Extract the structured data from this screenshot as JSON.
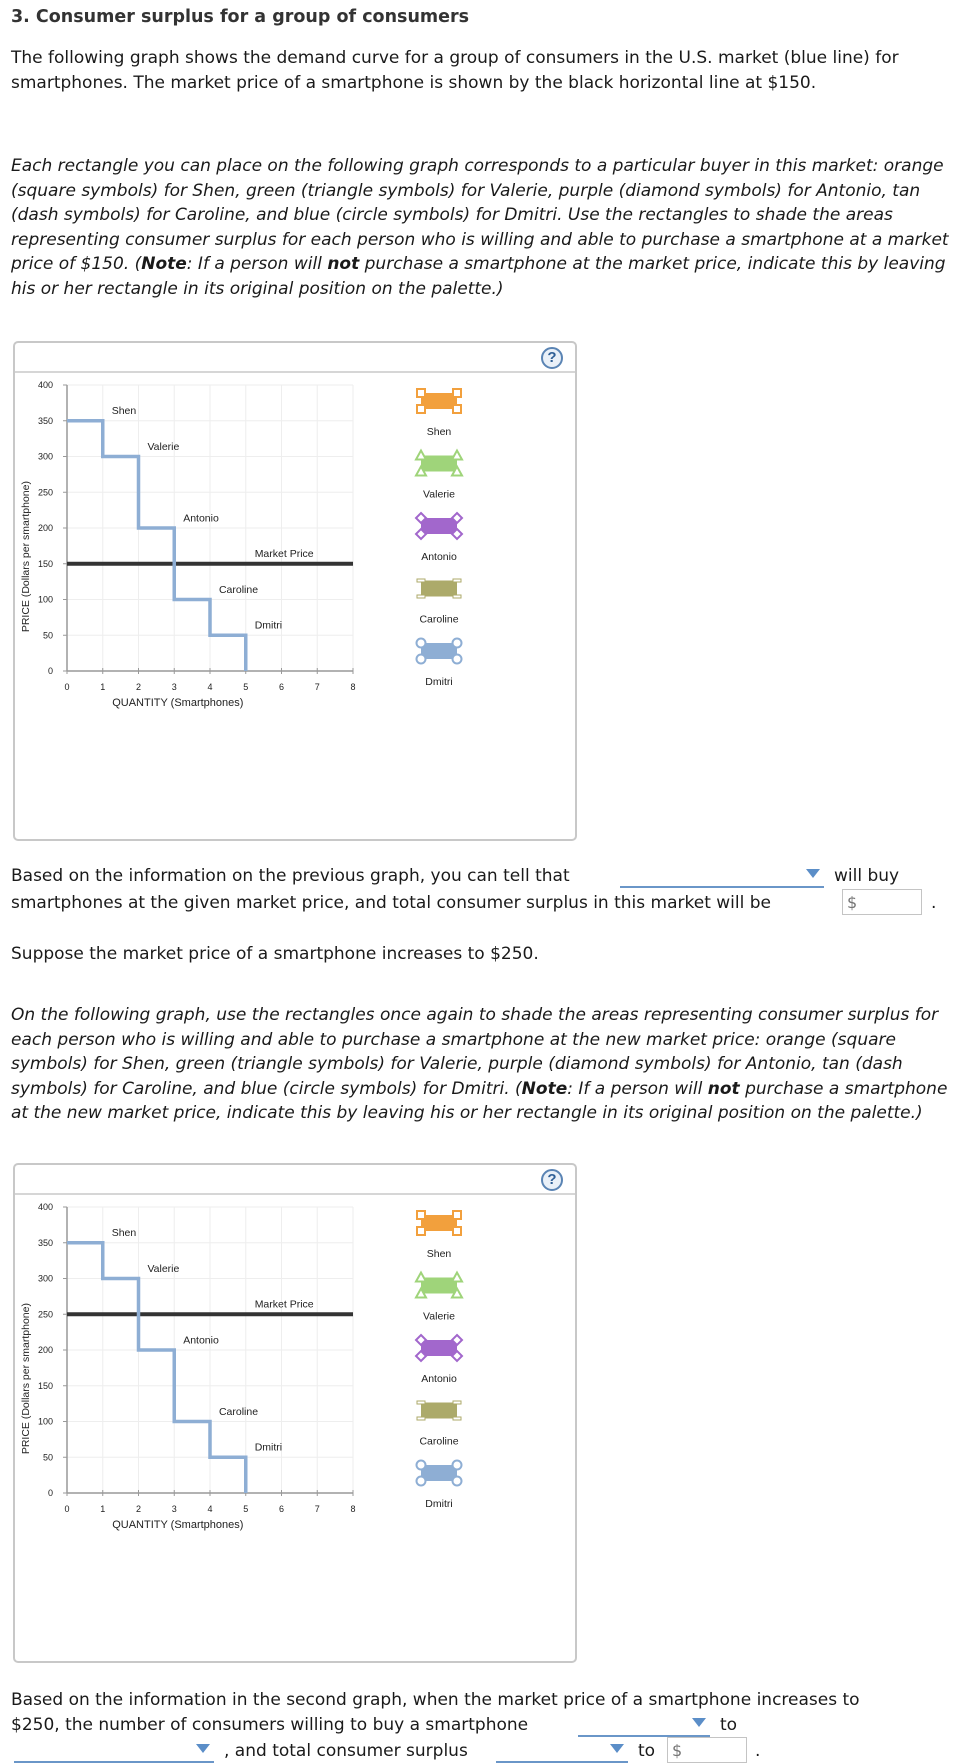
{
  "heading": "3. Consumer surplus for a group of consumers",
  "intro": "The following graph shows the demand curve for a group of consumers in the U.S. market (blue line) for smartphones. The market price of a smartphone is shown by the black horizontal line at $150.",
  "instructions1": {
    "part1": "Each rectangle you can place on the following graph corresponds to a particular buyer in this market: orange (square symbols) for Shen, green (triangle symbols) for Valerie, purple (diamond symbols) for Antonio, tan (dash symbols) for Caroline, and blue (circle symbols) for Dmitri. Use the rectangles to shade the areas representing consumer surplus for each person who is willing and able to purchase a smartphone at a market price of $150. (",
    "note": "Note",
    "part2": ": If a person will ",
    "not": "not",
    "part3": " purchase a smartphone at the market price, indicate this by leaving his or her rectangle in its original position on the palette.)"
  },
  "question1": {
    "before": "Based on the information on the previous graph, you can tell that",
    "after": "will buy",
    "line2": "smartphones at the given market price, and total consumer surplus in this market will be",
    "dollar_placeholder": "$",
    "end": ".",
    "dropdown_value": ""
  },
  "suppose": "Suppose the market price of a smartphone increases to $250.",
  "instructions2": {
    "part1": "On the following graph, use the rectangles once again to shade the areas representing consumer surplus for each person who is willing and able to purchase a smartphone at the new market price: orange (square symbols) for Shen, green (triangle symbols) for Valerie, purple (diamond symbols) for Antonio, tan (dash symbols) for Caroline, and blue (circle symbols) for Dmitri. (",
    "note": "Note",
    "part2": ": If a person will ",
    "not": "not",
    "part3": " purchase a smartphone at the new market price, indicate this by leaving his or her rectangle in its original position on the palette.)"
  },
  "question2": {
    "line1": "Based on the information in the second graph, when the market price of a smartphone increases to",
    "line2_before": "$250, the number of consumers willing to buy a smartphone",
    "to1": "to",
    "and_total": ", and total consumer surplus",
    "to2": "to",
    "dollar_placeholder": "$",
    "end": "."
  },
  "help_label": "?",
  "palette": [
    {
      "name": "Shen",
      "symbol": "square",
      "color": "#f2a03d"
    },
    {
      "name": "Valerie",
      "symbol": "triangle",
      "color": "#9fd47a"
    },
    {
      "name": "Antonio",
      "symbol": "diamond",
      "color": "#a267cc"
    },
    {
      "name": "Caroline",
      "symbol": "dash",
      "color": "#acaa6a"
    },
    {
      "name": "Dmitri",
      "symbol": "circle",
      "color": "#8eaed4"
    }
  ],
  "colors": {
    "demand": "#8eaed4",
    "market_price_line": "#333333",
    "accent": "#5b8ec8"
  },
  "chart_data": [
    {
      "type": "line",
      "title": "",
      "xlabel": "QUANTITY (Smartphones)",
      "ylabel": "PRICE (Dollars per smartphone)",
      "xlim": [
        0,
        8
      ],
      "ylim": [
        0,
        400
      ],
      "xticks": [
        0,
        1,
        2,
        3,
        4,
        5,
        6,
        7,
        8
      ],
      "yticks": [
        0,
        50,
        100,
        150,
        200,
        250,
        300,
        350,
        400
      ],
      "grid": true,
      "series": [
        {
          "name": "Demand",
          "step": true,
          "points": [
            [
              0,
              350
            ],
            [
              1,
              350
            ],
            [
              1,
              300
            ],
            [
              2,
              300
            ],
            [
              2,
              200
            ],
            [
              3,
              200
            ],
            [
              3,
              100
            ],
            [
              4,
              100
            ],
            [
              4,
              50
            ],
            [
              5,
              50
            ],
            [
              5,
              0
            ]
          ]
        },
        {
          "name": "Market Price",
          "y": 150
        }
      ],
      "annotations": [
        {
          "text": "Shen",
          "x": 1.25,
          "y": 365
        },
        {
          "text": "Valerie",
          "x": 2.25,
          "y": 315
        },
        {
          "text": "Antonio",
          "x": 3.25,
          "y": 215
        },
        {
          "text": "Market Price",
          "x": 5.25,
          "y": 165
        },
        {
          "text": "Caroline",
          "x": 4.25,
          "y": 115
        },
        {
          "text": "Dmitri",
          "x": 5.25,
          "y": 65
        }
      ]
    },
    {
      "type": "line",
      "title": "",
      "xlabel": "QUANTITY (Smartphones)",
      "ylabel": "PRICE (Dollars per smartphone)",
      "xlim": [
        0,
        8
      ],
      "ylim": [
        0,
        400
      ],
      "xticks": [
        0,
        1,
        2,
        3,
        4,
        5,
        6,
        7,
        8
      ],
      "yticks": [
        0,
        50,
        100,
        150,
        200,
        250,
        300,
        350,
        400
      ],
      "grid": true,
      "series": [
        {
          "name": "Demand",
          "step": true,
          "points": [
            [
              0,
              350
            ],
            [
              1,
              350
            ],
            [
              1,
              300
            ],
            [
              2,
              300
            ],
            [
              2,
              200
            ],
            [
              3,
              200
            ],
            [
              3,
              100
            ],
            [
              4,
              100
            ],
            [
              4,
              50
            ],
            [
              5,
              50
            ],
            [
              5,
              0
            ]
          ]
        },
        {
          "name": "Market Price",
          "y": 250
        }
      ],
      "annotations": [
        {
          "text": "Shen",
          "x": 1.25,
          "y": 365
        },
        {
          "text": "Valerie",
          "x": 2.25,
          "y": 315
        },
        {
          "text": "Market Price",
          "x": 5.25,
          "y": 265
        },
        {
          "text": "Antonio",
          "x": 3.25,
          "y": 215
        },
        {
          "text": "Caroline",
          "x": 4.25,
          "y": 115
        },
        {
          "text": "Dmitri",
          "x": 5.25,
          "y": 65
        }
      ]
    }
  ]
}
